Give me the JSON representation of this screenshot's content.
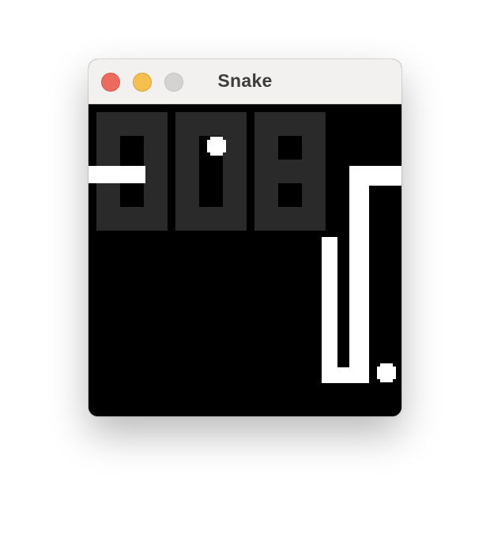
{
  "window": {
    "title": "Snake"
  },
  "game": {
    "score": "008",
    "colors": {
      "background": "#000000",
      "snake": "#ffffff",
      "food": "#ffffff",
      "score_digits": "#2a2a2a"
    },
    "icons": {
      "close": "close-button-circle",
      "minimize": "minimize-button-circle",
      "maximize": "maximize-button-circle"
    }
  }
}
